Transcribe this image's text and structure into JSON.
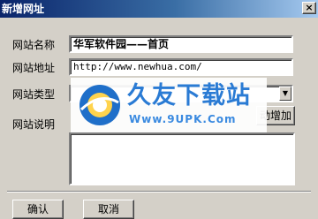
{
  "window": {
    "title": "新增网址",
    "close_label": "×"
  },
  "form": {
    "site_name": {
      "label": "网站名称",
      "value": "华军软件园——首页"
    },
    "site_url": {
      "label": "网站地址",
      "value": "http://www.newhua.com/"
    },
    "site_type": {
      "label": "网站类型",
      "value": "",
      "arrow": "▼"
    },
    "site_desc": {
      "label": "网站说明",
      "value": ""
    },
    "auto_add_label": "动增加"
  },
  "footer": {
    "confirm_label": "确认",
    "cancel_label": "取消"
  },
  "watermark": {
    "text": "久友下载站",
    "url": "Www.9UPK.Com"
  },
  "colors": {
    "title_start": "#0a246a",
    "title_end": "#a6caf0",
    "watermark_blue": "#2a7bd4"
  }
}
